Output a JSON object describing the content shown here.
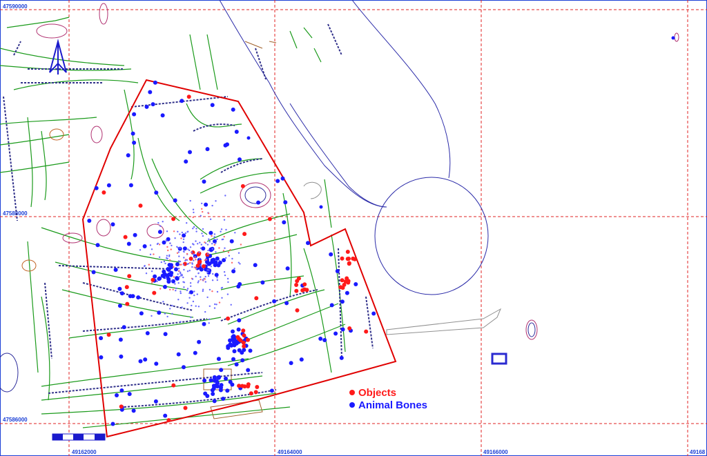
{
  "map": {
    "legend": {
      "items": [
        {
          "label": "Objects",
          "color": "#ff1a1a"
        },
        {
          "label": "Animal Bones",
          "color": "#1a1aff"
        }
      ]
    },
    "coordinates": {
      "y_labels": [
        "47590000",
        "47588000",
        "47586000"
      ],
      "x_labels": [
        "49162000",
        "49164000",
        "49166000",
        "49168"
      ]
    },
    "colors": {
      "grid": "#e02020",
      "boundary": "#e00000",
      "features": "#1a9a1a",
      "shoreline": "#2a2aa8",
      "objects": "#ff1a1a",
      "bones": "#1a1aff"
    },
    "icons": [
      "north-arrow-icon",
      "scale-bar-icon"
    ]
  }
}
